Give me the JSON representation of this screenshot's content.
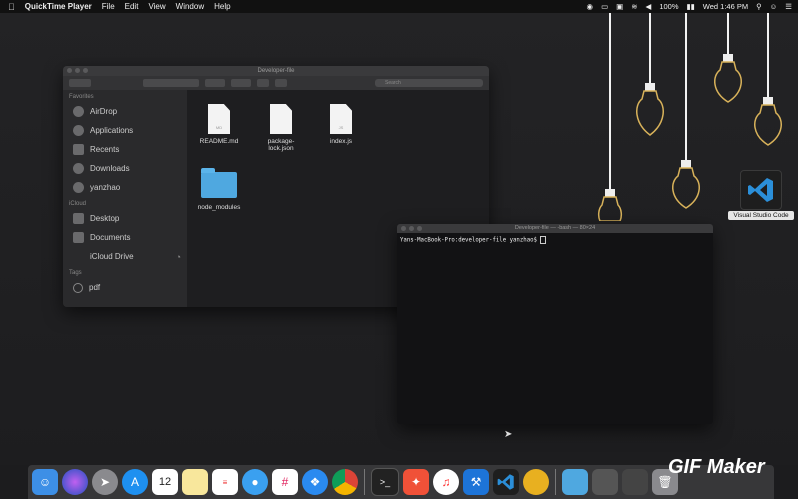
{
  "menubar": {
    "app_name": "QuickTime Player",
    "menus": [
      "File",
      "Edit",
      "View",
      "Window",
      "Help"
    ],
    "battery": "100%",
    "clock": "Wed 1:46 PM"
  },
  "finder": {
    "title": "Developer-file",
    "search_placeholder": "Search",
    "sidebar": {
      "favorites_header": "Favorites",
      "favorites": [
        "AirDrop",
        "Applications",
        "Recents",
        "Downloads",
        "yanzhao"
      ],
      "icloud_header": "iCloud",
      "icloud": [
        "Desktop",
        "Documents",
        "iCloud Drive"
      ],
      "tags_header": "Tags",
      "tags": [
        "pdf"
      ]
    },
    "files": [
      {
        "name": "README.md",
        "badge": "MD"
      },
      {
        "name": "package-lock.json",
        "badge": ""
      },
      {
        "name": "index.js",
        "badge": "JS"
      }
    ],
    "folders": [
      {
        "name": "node_modules"
      }
    ]
  },
  "terminal": {
    "title": "Developer-file — -bash — 80×24",
    "prompt": "Yans-MacBook-Pro:developer-file yanzhao$"
  },
  "desktop": {
    "vscode_label": "Visual Studio Code"
  },
  "watermark": {
    "text": "GIF Maker"
  },
  "colors": {
    "bulb_outline": "#d8b25a",
    "folder": "#4fa8e0",
    "vscode_blue": "#2b8fd9"
  },
  "dock": {
    "icons": [
      "finder-icon",
      "siri-icon",
      "launchpad-icon",
      "app-store-icon",
      "calendar-icon",
      "notes-icon",
      "reminders-icon",
      "messages-icon",
      "slack-icon",
      "safari-icon",
      "chrome-icon",
      "terminal-icon",
      "swift-icon",
      "music-icon",
      "xcode-icon",
      "vscode-icon",
      "chrome-canary-icon",
      "folder-icon",
      "screenshot-icon",
      "ui-app-icon",
      "trash-icon"
    ],
    "calendar_day": "12"
  }
}
